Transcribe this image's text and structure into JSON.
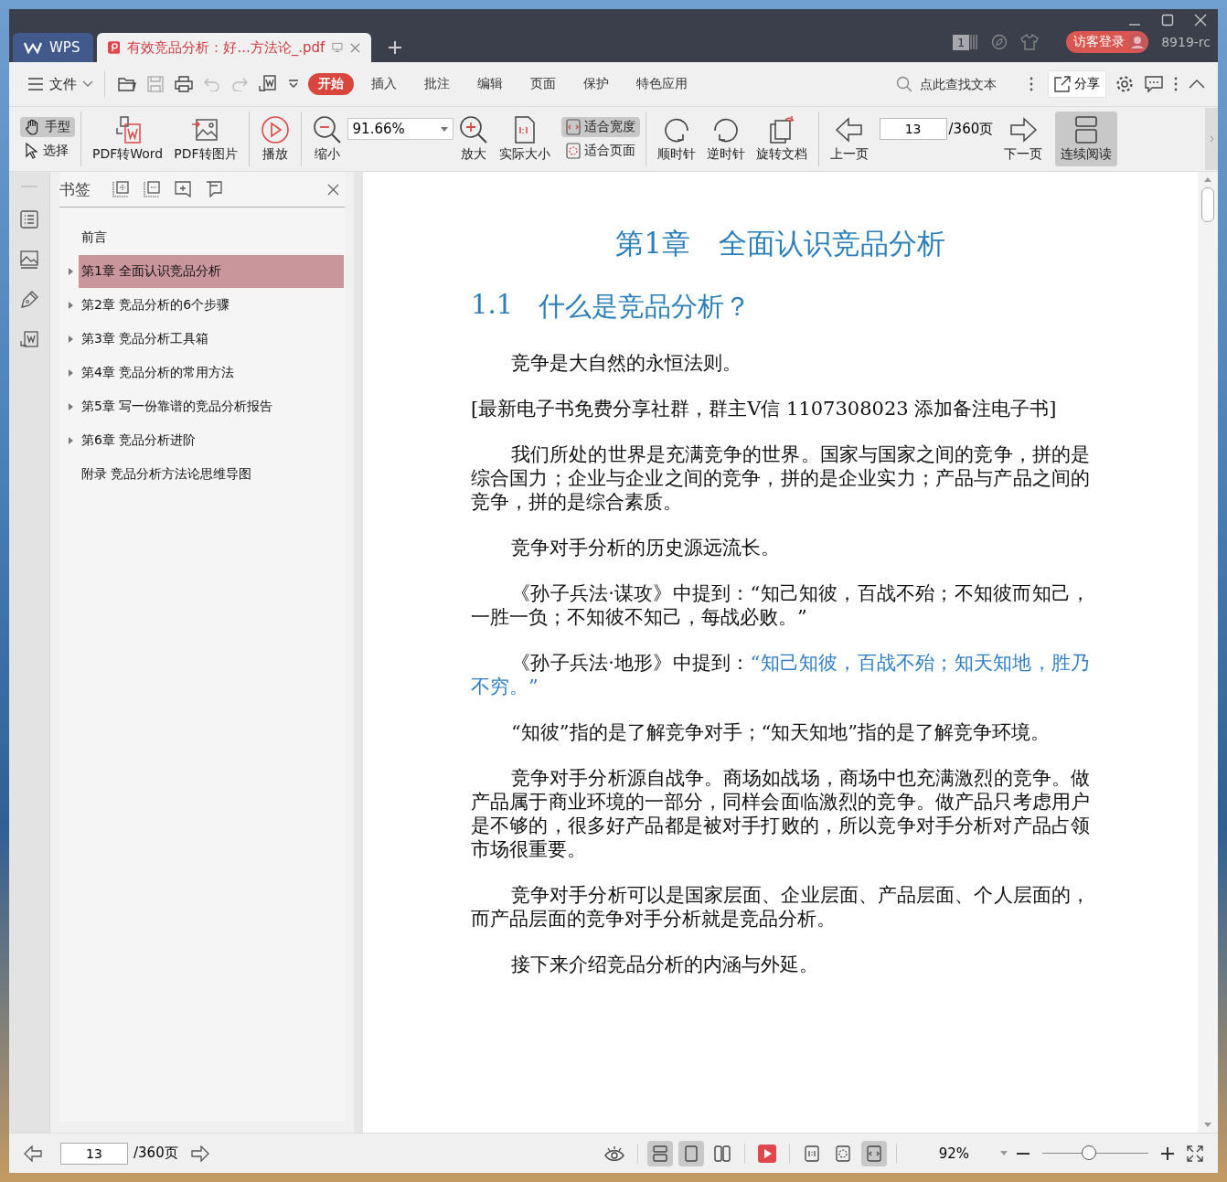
{
  "titlebar": {
    "tabs": [
      {
        "label": "WPS",
        "selected": false
      },
      {
        "label": "有效竞品分析：好...方法论_.pdf",
        "selected": true
      }
    ],
    "window_count": "1",
    "login": "访客登录",
    "user": "8919-rc"
  },
  "menubar": {
    "file": "文件",
    "tabs": [
      {
        "label": "开始",
        "selected": true
      },
      {
        "label": "插入",
        "selected": false
      },
      {
        "label": "批注",
        "selected": false
      },
      {
        "label": "编辑",
        "selected": false
      },
      {
        "label": "页面",
        "selected": false
      },
      {
        "label": "保护",
        "selected": false
      },
      {
        "label": "特色应用",
        "selected": false
      }
    ],
    "search": {
      "placeholder": "点此查找文本"
    },
    "share": "分享"
  },
  "toolbar": {
    "hand": {
      "label": "手型",
      "selected": true
    },
    "select": {
      "label": "选择",
      "selected": false
    },
    "convert": [
      "PDF转Word",
      "PDF转图片"
    ],
    "play": "播放",
    "zoom_out": "缩小",
    "zoom_value": "91.66%",
    "zoom_in": "放大",
    "actual_size": "实际大小",
    "fit": [
      {
        "label": "适合宽度",
        "selected": true
      },
      {
        "label": "适合页面",
        "selected": false
      }
    ],
    "rotate": [
      "顺时针",
      "逆时针",
      "旋转文档"
    ],
    "prev": "上一页",
    "page": "13",
    "total": "/360页",
    "next": "下一页",
    "continuous": {
      "label": "连续阅读",
      "selected": true
    }
  },
  "sidebar": {
    "title": "书签",
    "items": [
      {
        "label": "前言",
        "expandable": false,
        "selected": false
      },
      {
        "label": "第1章 全面认识竞品分析",
        "expandable": true,
        "selected": true
      },
      {
        "label": "第2章 竞品分析的6个步骤",
        "expandable": true,
        "selected": false
      },
      {
        "label": "第3章 竞品分析工具箱",
        "expandable": true,
        "selected": false
      },
      {
        "label": "第4章 竞品分析的常用方法",
        "expandable": true,
        "selected": false
      },
      {
        "label": "第5章 写一份靠谱的竞品分析报告",
        "expandable": true,
        "selected": false
      },
      {
        "label": "第6章 竞品分析进阶",
        "expandable": true,
        "selected": false
      },
      {
        "label": "附录 竞品分析方法论思维导图",
        "expandable": false,
        "selected": false
      }
    ]
  },
  "document": {
    "chapter": "第1章　全面认识竞品分析",
    "section_number": "1.1",
    "section_title": "什么是竞品分析？",
    "paragraphs": [
      {
        "kind": "indent",
        "parts": [
          {
            "text": "竞争是大自然的永恒法则。",
            "highlight": false
          }
        ]
      },
      {
        "kind": "plain",
        "parts": [
          {
            "text": "[最新电子书免费分享社群，群主V信 1107308023 添加备注电子书]",
            "highlight": false
          }
        ]
      },
      {
        "kind": "indent",
        "parts": [
          {
            "text": "我们所处的世界是充满竞争的世界。国家与国家之间的竞争，拼的是综合国力；企业与企业之间的竞争，拼的是企业实力；产品与产品之间的竞争，拼的是综合素质。",
            "highlight": false
          }
        ]
      },
      {
        "kind": "indent",
        "parts": [
          {
            "text": "竞争对手分析的历史源远流长。",
            "highlight": false
          }
        ]
      },
      {
        "kind": "indent",
        "parts": [
          {
            "text": "《孙子兵法·谋攻》中提到：“知己知彼，百战不殆；不知彼而知己，一胜一负；不知彼不知己，每战必败。”",
            "highlight": false
          }
        ]
      },
      {
        "kind": "indent",
        "parts": [
          {
            "text": "《孙子兵法·地形》中提到：",
            "highlight": false
          },
          {
            "text": "“知己知彼，百战不殆；知天知地，胜乃不穷。”",
            "highlight": true
          }
        ]
      },
      {
        "kind": "indent",
        "parts": [
          {
            "text": "“知彼”指的是了解竞争对手；“知天知地”指的是了解竞争环境。",
            "highlight": false
          }
        ]
      },
      {
        "kind": "indent",
        "parts": [
          {
            "text": "竞争对手分析源自战争。商场如战场，商场中也充满激烈的竞争。做产品属于商业环境的一部分，同样会面临激烈的竞争。做产品只考虑用户是不够的，很多好产品都是被对手打败的，所以竞争对手分析对产品占领市场很重要。",
            "highlight": false
          }
        ]
      },
      {
        "kind": "indent",
        "parts": [
          {
            "text": "竞争对手分析可以是国家层面、企业层面、产品层面、个人层面的，而产品层面的竞争对手分析就是竞品分析。",
            "highlight": false
          }
        ]
      },
      {
        "kind": "indent",
        "parts": [
          {
            "text": "接下来介绍竞品分析的内涵与外延。",
            "highlight": false
          }
        ]
      }
    ]
  },
  "statusbar": {
    "page": "13",
    "total": "/360页",
    "layouts": [
      {
        "selected": true
      },
      {
        "selected": true
      },
      {
        "selected": false
      }
    ],
    "fits": [
      {
        "selected": false
      },
      {
        "selected": false
      },
      {
        "selected": true
      }
    ],
    "zoom": "92%",
    "zoom_slider": {
      "level": 0.43
    }
  }
}
